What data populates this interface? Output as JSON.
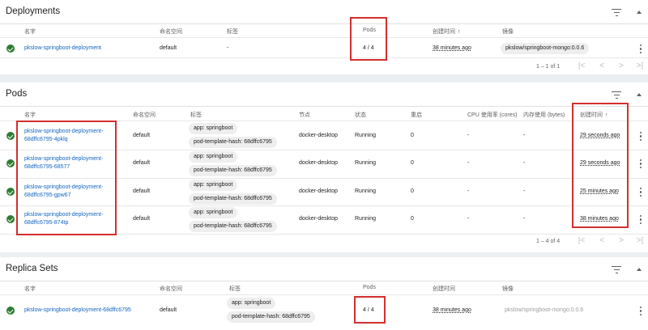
{
  "deployments": {
    "title": "Deployments",
    "columns": {
      "name": "名字",
      "namespace": "命名空间",
      "labels": "标签",
      "pods": "Pods",
      "created": "创建时间",
      "images": "镜像"
    },
    "sort_arrow": "↑",
    "rows": [
      {
        "name": "pkslow-springboot-deployment",
        "namespace": "default",
        "labels": "-",
        "pods": "4 / 4",
        "created": "38 minutes ago",
        "image": "pkslow/springboot-mongo:0.0.6"
      }
    ],
    "pagination": "1 – 1 of 1"
  },
  "pods": {
    "title": "Pods",
    "columns": {
      "name": "名字",
      "namespace": "命名空间",
      "labels": "标签",
      "node": "节点",
      "status": "状态",
      "restarts": "重启",
      "cpu": "CPU 使用率 (cores)",
      "memory": "内存使用 (bytes)",
      "created": "创建时间"
    },
    "sort_arrow": "↑",
    "rows": [
      {
        "name_line1": "pkslow-springboot-deployment-",
        "name_line2": "68dffc6795-4pklq",
        "namespace": "default",
        "label1": "app: springboot",
        "label2": "pod-template-hash: 68dffc6795",
        "node": "docker-desktop",
        "status": "Running",
        "restarts": "0",
        "cpu": "-",
        "memory": "-",
        "created": "29 seconds ago"
      },
      {
        "name_line1": "pkslow-springboot-deployment-",
        "name_line2": "68dffc6795-68577",
        "namespace": "default",
        "label1": "app: springboot",
        "label2": "pod-template-hash: 68dffc6795",
        "node": "docker-desktop",
        "status": "Running",
        "restarts": "0",
        "cpu": "-",
        "memory": "-",
        "created": "29 seconds ago"
      },
      {
        "name_line1": "pkslow-springboot-deployment-",
        "name_line2": "68dffc6795-gpw67",
        "namespace": "default",
        "label1": "app: springboot",
        "label2": "pod-template-hash: 68dffc6795",
        "node": "docker-desktop",
        "status": "Running",
        "restarts": "0",
        "cpu": "-",
        "memory": "-",
        "created": "25 minutes ago"
      },
      {
        "name_line1": "pkslow-springboot-deployment-",
        "name_line2": "68dffc6795-874tp",
        "namespace": "default",
        "label1": "app: springboot",
        "label2": "pod-template-hash: 68dffc6795",
        "node": "docker-desktop",
        "status": "Running",
        "restarts": "0",
        "cpu": "-",
        "memory": "-",
        "created": "38 minutes ago"
      }
    ],
    "pagination": "1 – 4 of 4"
  },
  "replicasets": {
    "title": "Replica Sets",
    "columns": {
      "name": "名字",
      "namespace": "命名空间",
      "labels": "标签",
      "pods": "Pods",
      "created": "创建时间",
      "images": "镜像"
    },
    "rows": [
      {
        "name": "pkslow-springboot-deployment-68dffc6795",
        "namespace": "default",
        "label1": "app: springboot",
        "label2": "pod-template-hash: 68dffc6795",
        "pods": "4 / 4",
        "created": "38 minutes ago",
        "image": "pkslow/springboot-mongo:0.0.6"
      }
    ]
  },
  "icons": {
    "filter": "filter-icon",
    "collapse": "chevron-up-icon",
    "status": "check-circle-icon",
    "menu": "more-vert-icon",
    "first": "first-page-icon",
    "prev": "chevron-left-icon",
    "next": "chevron-right-icon",
    "last": "last-page-icon"
  },
  "colors": {
    "link": "#1565c0",
    "success": "#2e7d32",
    "highlight": "#d32f2f"
  }
}
